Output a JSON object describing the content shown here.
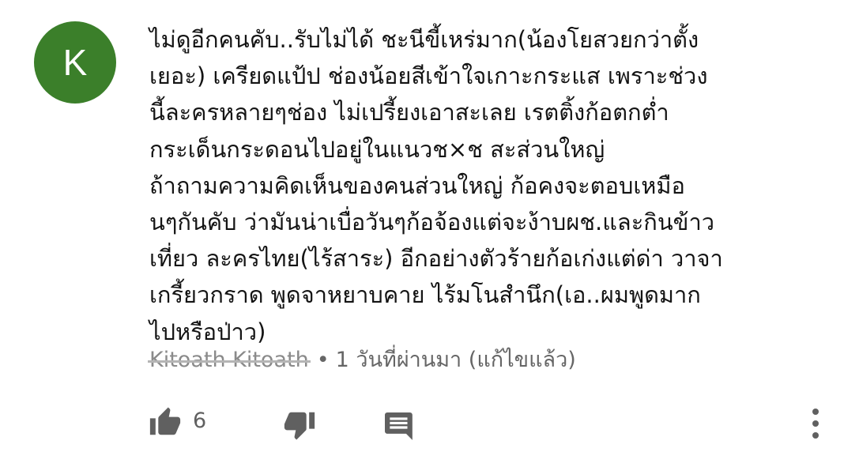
{
  "avatar": {
    "letter": "K",
    "color": "#3b7f2a"
  },
  "comment": {
    "lines": [
      "ไม่ดูอีกคนคับ..รับไม่ได้ ชะนีขี้เหร่มาก(น้องโยสวยกว่าตั้ง",
      "เยอะ) เครียดแป้ป ช่องน้อยสีเข้าใจเกาะกระแส เพราะช่วง",
      "นี้ละครหลายๆช่อง ไม่เปรี้ยงเอาสะเลย เรตติ้งก้อตกต่ำ",
      "กระเด็นกระดอนไปอยู่ในแนวช×ช สะส่วนใหญ่",
      "ถ้าถามความคิดเห็นของคนส่วนใหญ่ ก้อคงจะตอบเหมือ",
      "นๆกันคับ ว่ามันน่าเบื่อวันๆก้อจ้องแต่จะง้าบผช.และกินข้าว",
      "เที่ยว ละครไทย(ไร้สาระ) อีกอย่างตัวร้ายก้อเก่งแต่ด่า วาจา",
      "เกรี้ยวกราด พูดจาหยาบคาย ไร้มโนสำนึก(เอ..ผมพูดมาก",
      "ไปหรือป่าว)"
    ],
    "author": "Kitoath Kitoath",
    "separator": "•",
    "timestamp": "1 วันที่ผ่านมา (แก้ไขแล้ว)"
  },
  "actions": {
    "like_icon": "thumbs-up-icon",
    "like_count": "6",
    "dislike_icon": "thumbs-down-icon",
    "reply_icon": "comment-icon",
    "more_icon": "more-vertical-icon"
  }
}
